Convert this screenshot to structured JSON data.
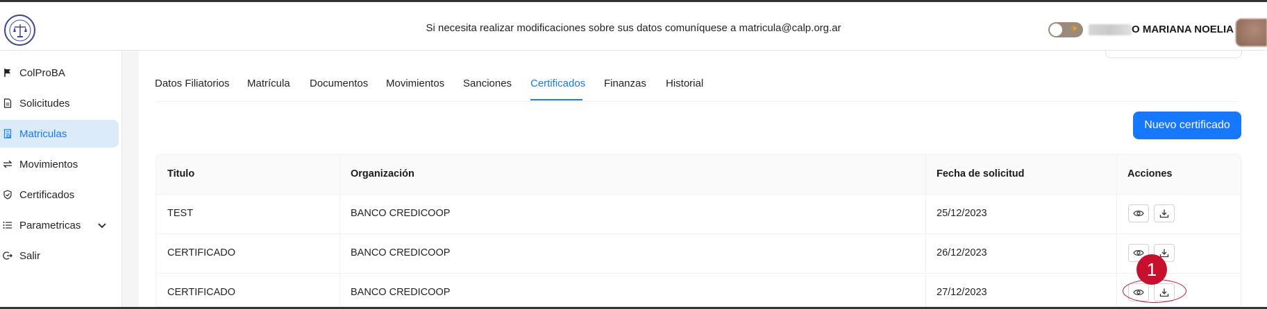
{
  "header": {
    "notice": "Si necesita realizar modificaciones sobre sus datos comuníquese a matricula@calp.org.ar",
    "user_name": "O MARIANA NOELIA"
  },
  "sidebar": {
    "items": [
      {
        "label": "ColProBA",
        "icon": "flag-icon"
      },
      {
        "label": "Solicitudes",
        "icon": "document-icon"
      },
      {
        "label": "Matriculas",
        "icon": "id-card-icon",
        "active": true
      },
      {
        "label": "Movimientos",
        "icon": "swap-icon"
      },
      {
        "label": "Certificados",
        "icon": "shield-check-icon"
      },
      {
        "label": "Parametricas",
        "icon": "list-icon"
      },
      {
        "label": "Salir",
        "icon": "logout-icon"
      }
    ]
  },
  "tabs": [
    {
      "label": "Datos Filiatorios"
    },
    {
      "label": "Matrícula"
    },
    {
      "label": "Documentos"
    },
    {
      "label": "Movimientos"
    },
    {
      "label": "Sanciones"
    },
    {
      "label": "Certificados",
      "active": true
    },
    {
      "label": "Finanzas"
    },
    {
      "label": "Historial"
    }
  ],
  "actions": {
    "new_certificate": "Nuevo certificado"
  },
  "table": {
    "headers": [
      "Titulo",
      "Organización",
      "Fecha de solicitud",
      "Acciones"
    ],
    "rows": [
      {
        "titulo": "TEST",
        "organizacion": "BANCO CREDICOOP",
        "fecha": "25/12/2023"
      },
      {
        "titulo": "CERTIFICADO",
        "organizacion": "BANCO CREDICOOP",
        "fecha": "26/12/2023"
      },
      {
        "titulo": "CERTIFICADO",
        "organizacion": "BANCO CREDICOOP",
        "fecha": "27/12/2023"
      }
    ]
  },
  "annotation": {
    "label": "1",
    "color": "#c8102e"
  },
  "colors": {
    "primary": "#1677ff",
    "active_bg": "#dcebf9"
  }
}
